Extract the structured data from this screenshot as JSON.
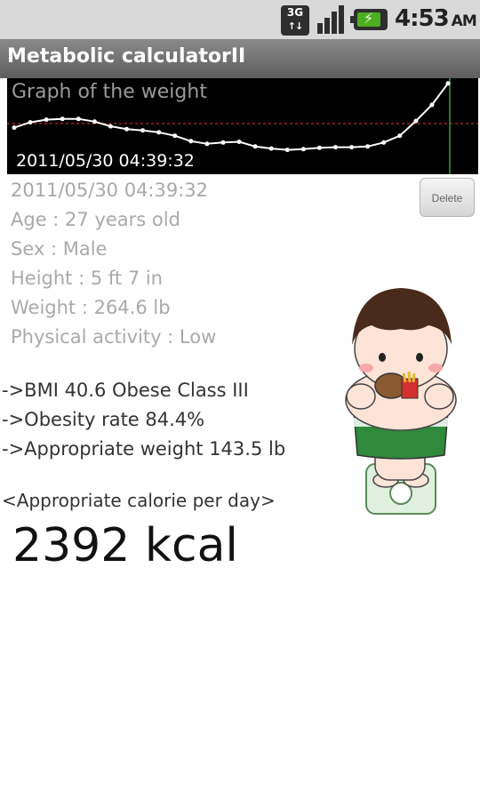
{
  "status_bar": {
    "network": "3G",
    "time": "4:53",
    "ampm": "AM"
  },
  "app": {
    "title": "Metabolic calculatorII"
  },
  "graph": {
    "title": "Graph of the weight",
    "date": "2011/05/30 04:39:32",
    "weights": [
      264,
      272,
      276,
      277,
      277,
      273,
      266,
      262,
      260,
      257,
      252,
      244,
      240,
      242,
      243,
      236,
      233,
      231,
      232,
      234,
      235,
      235,
      236,
      242,
      252,
      274,
      298,
      330
    ]
  },
  "record": {
    "datetime": "2011/05/30 04:39:32",
    "age": "Age : 27 years old",
    "sex": "Sex : Male",
    "height": "Height : 5 ft  7 in",
    "weight": "Weight : 264.6 lb",
    "activity": "Physical activity : Low",
    "delete_label": "Delete"
  },
  "results": {
    "bmi": "->BMI  40.6   Obese Class III",
    "obesity_rate": "->Obesity rate  84.4%",
    "appropriate_weight": "->Appropriate weight 143.5 lb"
  },
  "calorie": {
    "label": "<Appropriate calorie per day>",
    "value": "2392 kcal"
  }
}
